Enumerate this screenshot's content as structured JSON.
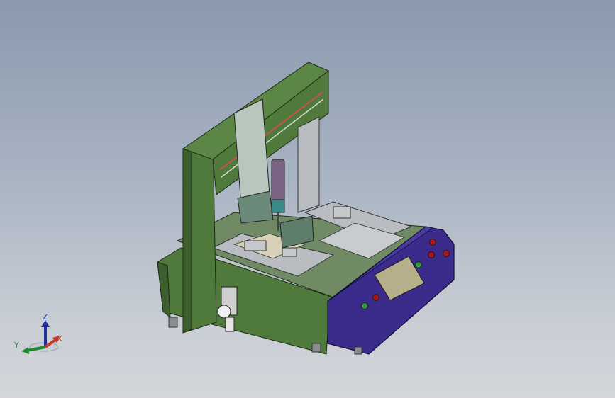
{
  "triad": {
    "x_label": "X",
    "y_label": "Y",
    "z_label": "Z",
    "x_color": "#c0392b",
    "y_color": "#1e8a2e",
    "z_color": "#1f2f9c"
  },
  "colors": {
    "frame_green": "#4f7a3c",
    "frame_green_dark": "#3c5e2d",
    "base_purple": "#3b2b8a",
    "base_purple_dark": "#2a1f66",
    "steel_grey": "#b9bcc0",
    "background_top": "#8a99ae",
    "background_bottom": "#d4d6da"
  }
}
